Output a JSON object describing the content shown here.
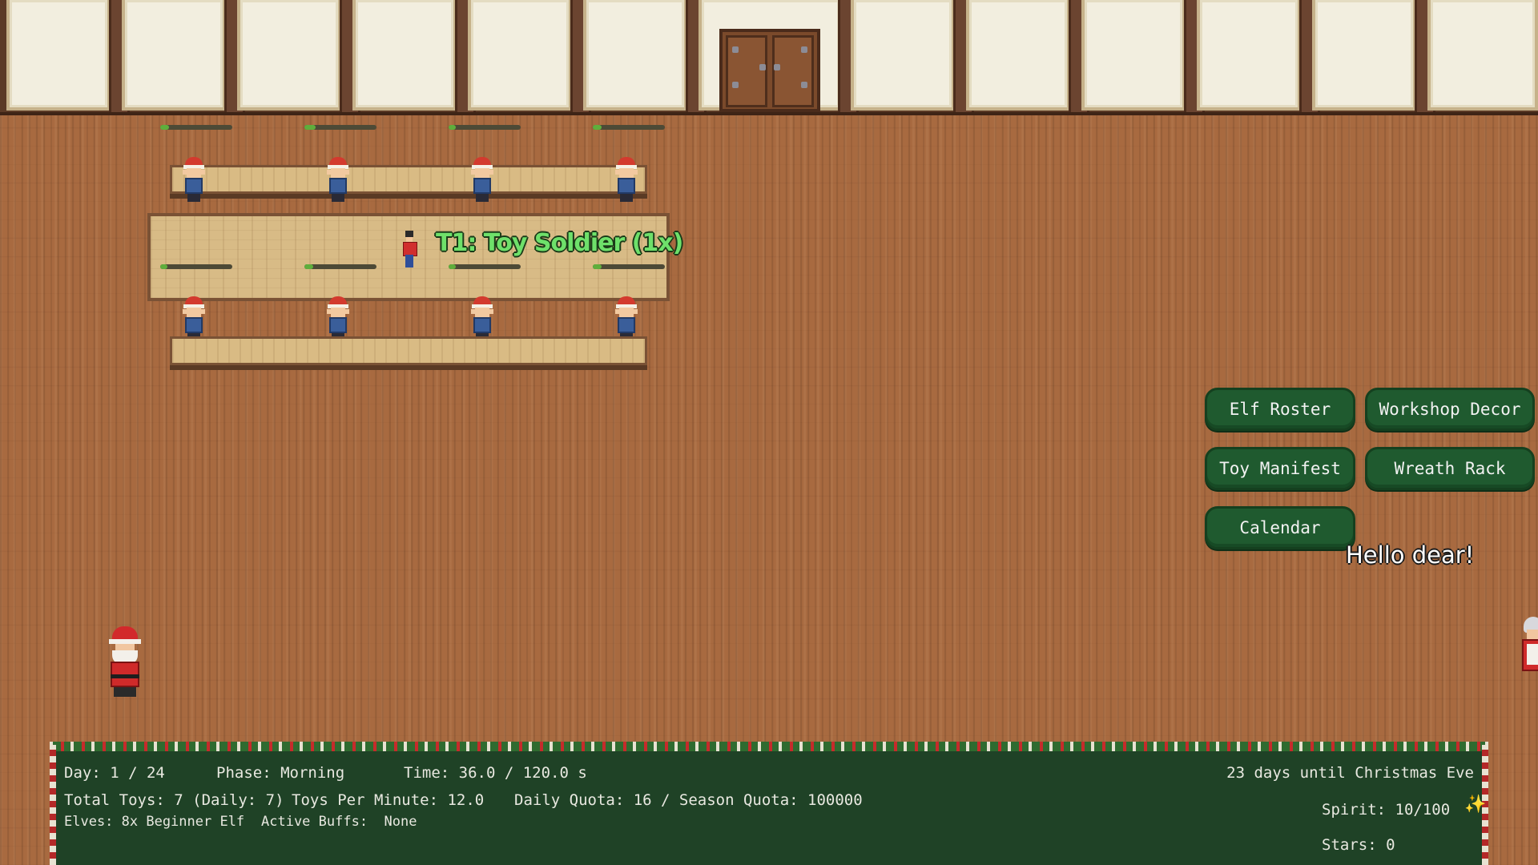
{
  "task": {
    "label": "T1: Toy Soldier (1x)"
  },
  "speech": {
    "text": "Hello dear!"
  },
  "menu": {
    "elf_roster": "Elf Roster",
    "workshop_decor": "Workshop Decor",
    "toy_manifest": "Toy Manifest",
    "wreath_rack": "Wreath Rack",
    "calendar": "Calendar"
  },
  "hud": {
    "day": "Day: 1 / 24",
    "phase": "Phase: Morning",
    "time": "Time: 36.0 / 120.0 s",
    "countdown": "23 days until Christmas Eve",
    "total_toys": "Total Toys: 7 (Daily: 7)",
    "toys_per_minute": "Toys Per Minute: 12.0",
    "quota": "Daily Quota: 16 / Season Quota: 100000",
    "elves": "Elves: 8x Beginner Elf",
    "buffs": "Active Buffs:  None",
    "spirit": "Spirit: 10/100",
    "stars": "Stars: 0",
    "sparkle_icon": "✨"
  },
  "elf_progress": [
    0.12,
    0.15,
    0.1,
    0.12,
    0.1,
    0.12,
    0.1,
    0.12
  ],
  "colors": {
    "button_green": "#1f5a2f",
    "hud_green": "#1f4226",
    "label_green": "#6ee06a"
  }
}
